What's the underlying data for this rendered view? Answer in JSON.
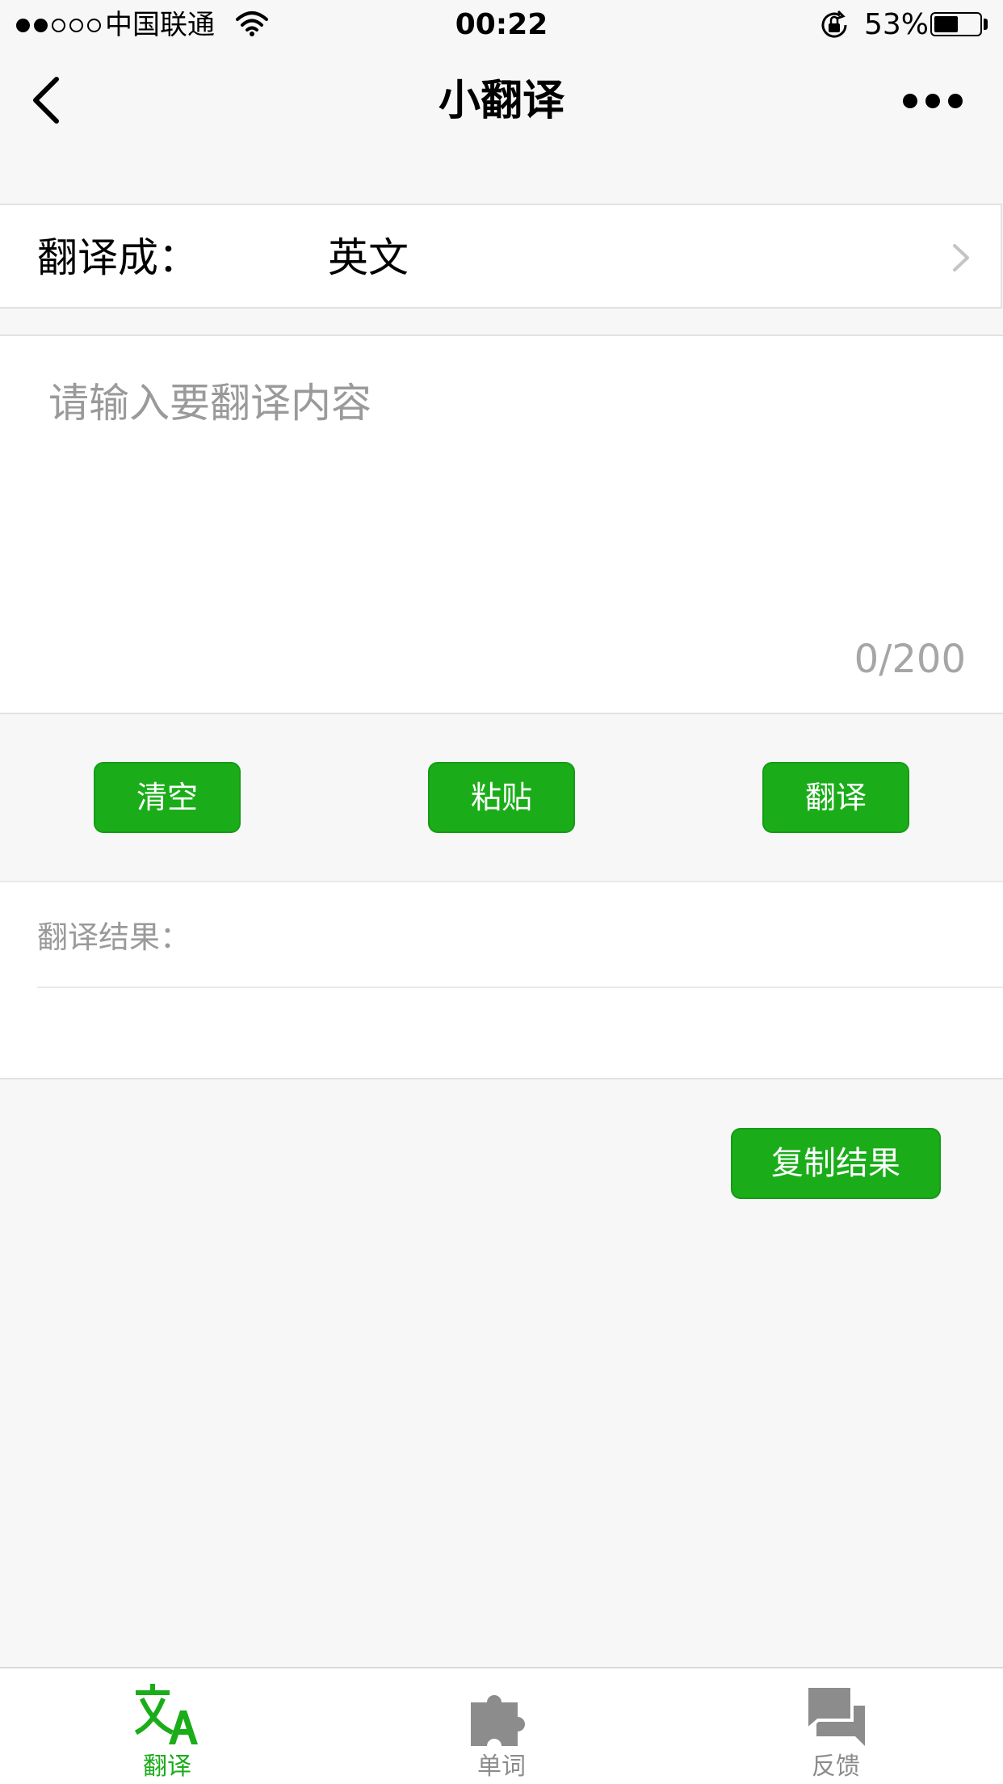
{
  "status_bar": {
    "carrier": "中国联通",
    "time": "00:22",
    "battery_percent": "53%",
    "battery_level": 0.53,
    "signal_bars": 2,
    "signal_total": 5,
    "icons": [
      "signal-dots-icon",
      "wifi-icon",
      "rotation-lock-icon",
      "battery-icon"
    ]
  },
  "nav": {
    "title": "小翻译",
    "back_icon": "chevron-left-icon",
    "more_icon": "more-dots-icon"
  },
  "language": {
    "label": "翻译成：",
    "value": "英文",
    "chevron_icon": "chevron-right-icon"
  },
  "input": {
    "value": "",
    "placeholder": "请输入要翻译内容",
    "counter": "0/200"
  },
  "actions": {
    "clear_label": "清空",
    "paste_label": "粘贴",
    "translate_label": "翻译"
  },
  "result": {
    "label": "翻译结果：",
    "text": ""
  },
  "copy": {
    "label": "复制结果"
  },
  "tabs": [
    {
      "label": "翻译",
      "icon": "translate-icon",
      "active": true
    },
    {
      "label": "单词",
      "icon": "puzzle-icon",
      "active": false
    },
    {
      "label": "反馈",
      "icon": "chat-icon",
      "active": false
    }
  ],
  "colors": {
    "accent": "#1aad19",
    "tab_inactive": "#8c8c8c",
    "background": "#f7f7f7"
  }
}
